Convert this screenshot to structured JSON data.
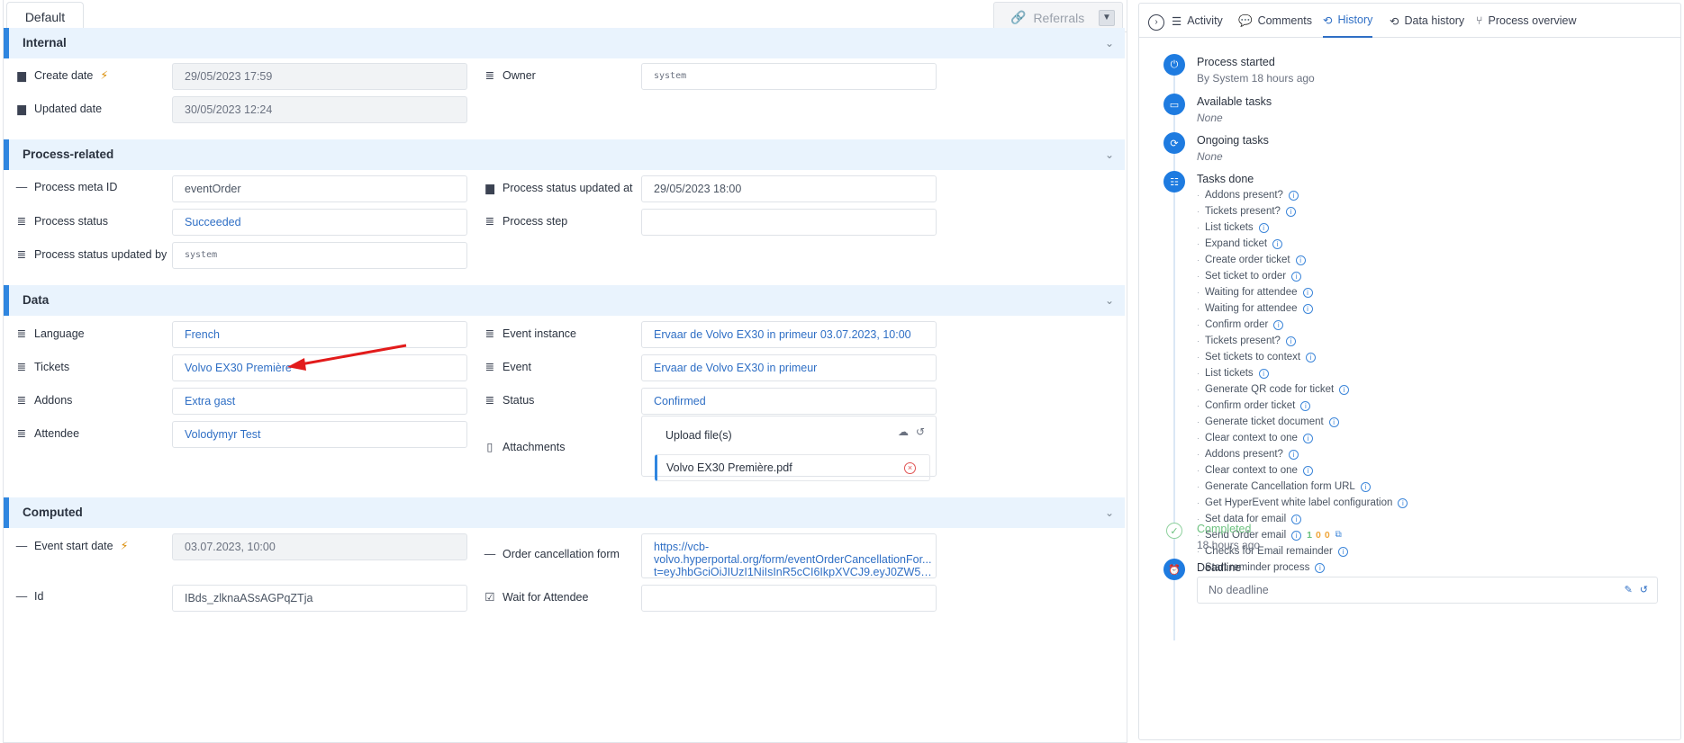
{
  "tabs": {
    "default_label": "Default",
    "referrals_label": "Referrals"
  },
  "sections": {
    "internal": "Internal",
    "process_related": "Process-related",
    "data": "Data",
    "computed": "Computed"
  },
  "internal": {
    "create_date_label": "Create date",
    "create_date_value": "29/05/2023 17:59",
    "owner_label": "Owner",
    "owner_value": "system",
    "updated_date_label": "Updated date",
    "updated_date_value": "30/05/2023 12:24"
  },
  "process": {
    "meta_id_label": "Process meta ID",
    "meta_id_value": "eventOrder",
    "status_updated_at_label": "Process status updated at",
    "status_updated_at_value": "29/05/2023 18:00",
    "status_label": "Process status",
    "status_value": "Succeeded",
    "step_label": "Process step",
    "step_value": "",
    "status_updated_by_label": "Process status updated by",
    "status_updated_by_value": "system"
  },
  "data": {
    "language_label": "Language",
    "language_value": "French",
    "event_instance_label": "Event instance",
    "event_instance_value": "Ervaar de Volvo EX30 in primeur 03.07.2023, 10:00",
    "tickets_label": "Tickets",
    "tickets_value": "Volvo EX30 Première",
    "event_label": "Event",
    "event_value": "Ervaar de Volvo EX30 in primeur",
    "addons_label": "Addons",
    "addons_value": "Extra gast",
    "status_label": "Status",
    "status_value": "Confirmed",
    "attendee_label": "Attendee",
    "attendee_value": "Volodymyr Test",
    "attachments_label": "Attachments",
    "upload_label": "Upload file(s)",
    "file_name": "Volvo EX30 Première.pdf"
  },
  "computed": {
    "event_start_label": "Event start date",
    "event_start_value": "03.07.2023, 10:00",
    "cancel_form_label": "Order cancellation form",
    "cancel_form_line1": "https://vcb-",
    "cancel_form_line2": "volvo.hyperportal.org/form/eventOrderCancellationFor...",
    "cancel_form_line3": "t=eyJhbGciOiJIUzI1NiIsInR5cCI6IkpXVCJ9.eyJ0ZW5hb...",
    "id_label": "Id",
    "id_value": "IBds_zlknaASsAGPqZTja",
    "wait_label": "Wait for Attendee",
    "wait_value": ""
  },
  "right_tabs": [
    "Activity",
    "Comments",
    "History",
    "Data history",
    "Process overview"
  ],
  "timeline": {
    "started_title": "Process started",
    "started_sub": "By System 18 hours ago",
    "available_title": "Available tasks",
    "available_sub": "None",
    "ongoing_title": "Ongoing tasks",
    "ongoing_sub": "None",
    "done_title": "Tasks done",
    "completed_title": "Completed",
    "completed_sub": "18 hours ago",
    "deadline_title": "Deadline",
    "deadline_value": "No deadline"
  },
  "tasks_done": [
    "Addons present?",
    "Tickets present?",
    "List tickets",
    "Expand ticket",
    "Create order ticket",
    "Set ticket to order",
    "Waiting for attendee",
    "Waiting for attendee",
    "Confirm order",
    "Tickets present?",
    "Set tickets to context",
    "List tickets",
    "Generate QR code for ticket",
    "Confirm order ticket",
    "Generate ticket document",
    "Clear context to one",
    "Addons present?",
    "Clear context to one",
    "Generate Cancellation form URL",
    "Get HyperEvent white label configuration",
    "Set data for email",
    "Send Order email",
    "Checks for Email remainder",
    "Start reminder process"
  ],
  "send_email_counts": [
    "1",
    "0",
    "0"
  ]
}
